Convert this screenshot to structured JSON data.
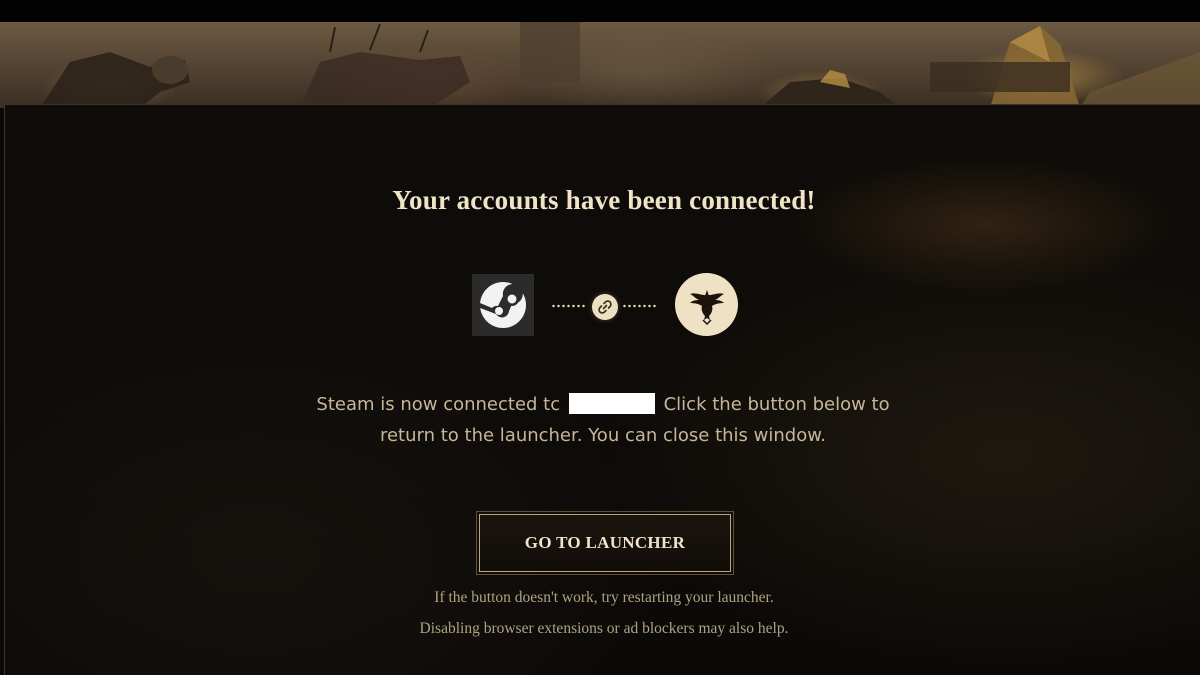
{
  "page": {
    "title": "Your accounts have been connected!",
    "icons": {
      "steam": "steam-icon",
      "link": "chain-link-icon",
      "game": "eagle-crest-icon"
    },
    "message": {
      "before_redaction": "Steam is now connected tc",
      "after_redaction": "Click the button below to",
      "line2": "return to the launcher. You can close this window."
    },
    "button_label": "GO TO LAUNCHER",
    "help_line1": "If the button doesn't work, try restarting your launcher.",
    "help_line2": "Disabling browser extensions or ad blockers may also help."
  },
  "colors": {
    "background": "#0b0907",
    "title": "#f0e3c6",
    "body_text": "#c5b797",
    "accent_gold": "#bfa67a",
    "badge_cream": "#efe2c4"
  }
}
